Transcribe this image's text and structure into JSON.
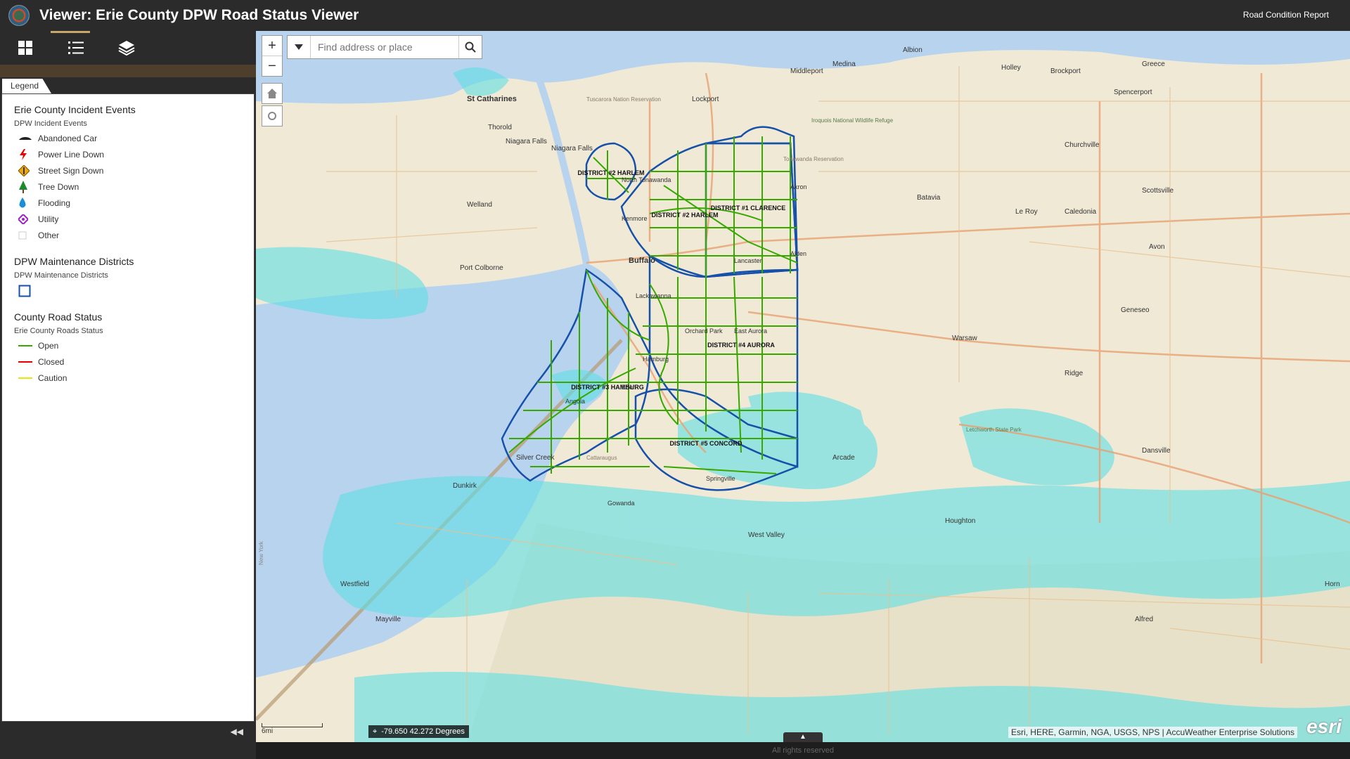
{
  "header": {
    "title": "Viewer: Erie County DPW Road Status Viewer",
    "report_link": "Road Condition Report"
  },
  "legend_tab": "Legend",
  "legend": {
    "incidents": {
      "title": "Erie County Incident Events",
      "subtitle": "DPW Incident Events",
      "items": [
        "Abandoned Car",
        "Power Line Down",
        "Street Sign Down",
        "Tree Down",
        "Flooding",
        "Utility",
        "Other"
      ]
    },
    "districts": {
      "title": "DPW Maintenance Districts",
      "subtitle": "DPW Maintenance Districts"
    },
    "roads": {
      "title": "County Road Status",
      "subtitle": "Erie County Roads Status",
      "items": [
        {
          "label": "Open",
          "color": "#38a800"
        },
        {
          "label": "Closed",
          "color": "#e60000"
        },
        {
          "label": "Caution",
          "color": "#ffff00"
        }
      ]
    }
  },
  "search": {
    "placeholder": "Find address or place"
  },
  "coords": "-79.650 42.272 Degrees",
  "attribution": "Esri, HERE, Garmin, NGA, USGS, NPS | AccuWeather Enterprise Solutions",
  "esri": "esri",
  "scale_label": "6mi",
  "footer": "All rights reserved",
  "map_labels": {
    "st_catharines": "St Catharines",
    "thorold": "Thorold",
    "niagara_falls_ca": "Niagara Falls",
    "niagara_falls_us": "Niagara Falls",
    "welland": "Welland",
    "port_colborne": "Port Colborne",
    "lockport": "Lockport",
    "middleport": "Middleport",
    "medina": "Medina",
    "albion": "Albion",
    "holley": "Holley",
    "brockport": "Brockport",
    "greece": "Greece",
    "spencerport": "Spencerport",
    "churchville": "Churchville",
    "scottsville": "Scottsville",
    "batavia": "Batavia",
    "le_roy": "Le Roy",
    "caledonia": "Caledonia",
    "avon": "Avon",
    "geneseo": "Geneseo",
    "warsaw": "Warsaw",
    "ridge": "Ridge",
    "dansville": "Dansville",
    "arcade": "Arcade",
    "houghton": "Houghton",
    "west_valley": "West Valley",
    "dunkirk": "Dunkirk",
    "silver_creek": "Silver Creek",
    "westfield": "Westfield",
    "mayville": "Mayville",
    "alfred": "Alfred",
    "north_tonawanda": "North Tonawanda",
    "kenmore": "Kenmore",
    "buffalo": "Buffalo",
    "lackawanna": "Lackawanna",
    "orchard_park": "Orchard Park",
    "east_aurora": "East Aurora",
    "hamburg": "Hamburg",
    "eden": "Eden",
    "angola": "Angola",
    "springville": "Springville",
    "gowanda": "Gowanda",
    "lancaster": "Lancaster",
    "akron": "Akron",
    "alden": "Alden",
    "iroquois": "Iroquois National Wildlife Refuge",
    "tuscarora": "Tuscarora Nation Reservation",
    "tonawanda_res": "Tonawanda Reservation",
    "letchworth": "Letchworth State Park",
    "cattaraugus": "Cattaraugus",
    "new_york": "New York",
    "d2_north": "DISTRICT #2 HARLEM",
    "d2": "DISTRICT #2 HARLEM",
    "d1": "DISTRICT #1 CLARENCE",
    "d4": "DISTRICT #4 AURORA",
    "d3": "DISTRICT #3 HAMBURG",
    "d5": "DISTRICT #5 CONCORD",
    "hornell": "Horn"
  },
  "icons": {
    "grid": "grid-icon",
    "list": "list-icon",
    "layers": "layers-icon",
    "search": "search-icon",
    "home": "home-icon",
    "locate": "locate-icon"
  }
}
